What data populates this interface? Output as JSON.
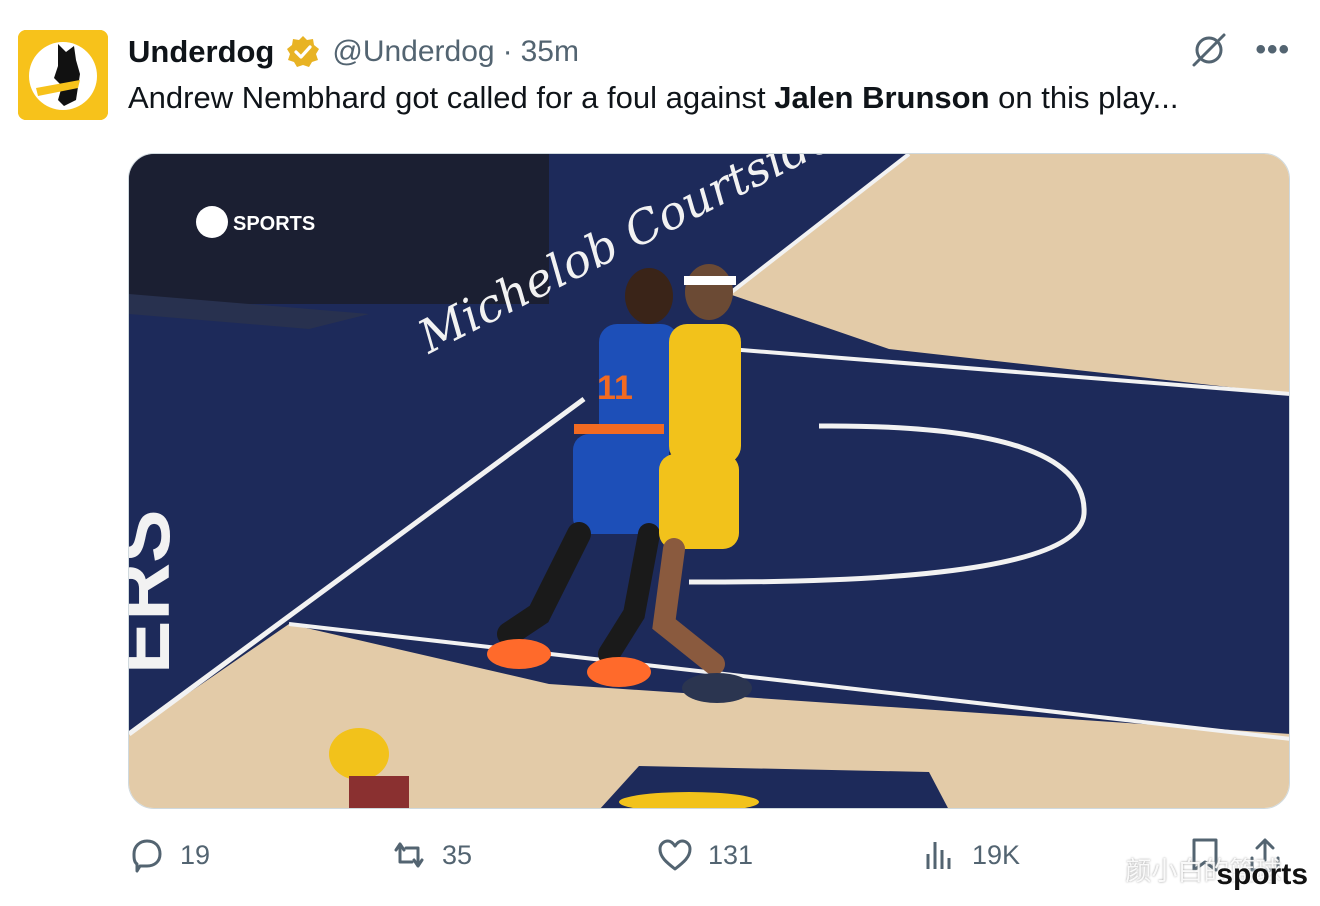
{
  "account": {
    "name": "Underdog",
    "handle": "@Underdog",
    "separator": "·",
    "time": "35m"
  },
  "tweet": {
    "text_before": "Andrew Nembhard got called for a foul against ",
    "text_bold": "Jalen Brunson",
    "text_after": " on this play..."
  },
  "media": {
    "broadcast_logo_text": "SPORTS",
    "court_text": "Michelob Courtside",
    "court_side_text": "ERS",
    "player_jersey": "11"
  },
  "actions": {
    "replies": "19",
    "reposts": "35",
    "likes": "131",
    "views": "19K"
  },
  "watermark": {
    "text": "sports",
    "cn_text": "颜小白的篮球·"
  },
  "colors": {
    "brand": "#f7c21b",
    "verified": "#e8b324",
    "court_blue": "#1d2a5a",
    "court_wood": "#e3cba8"
  }
}
